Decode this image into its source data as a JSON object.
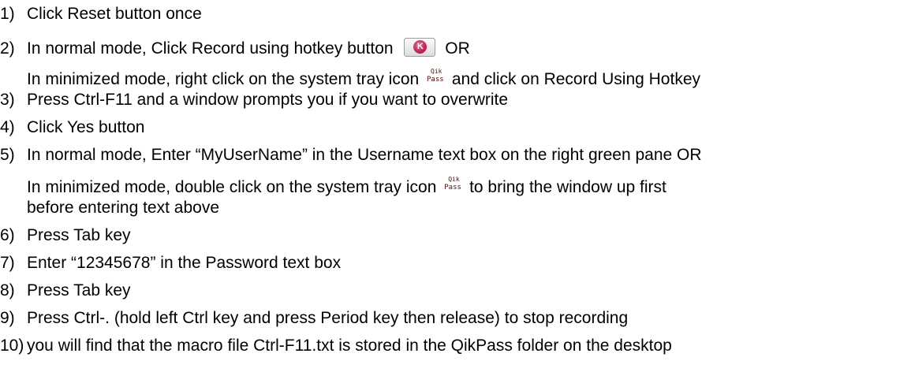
{
  "steps": [
    {
      "num": "1)",
      "text": "Click Reset button once"
    },
    {
      "num": "2)",
      "text_before": "In normal mode, Click Record using hotkey button",
      "button_letter": "K",
      "text_after": "OR",
      "cont_before": "In minimized mode, right click on the system tray icon",
      "tray_top": "Qik",
      "tray_bottom": "Pass",
      "cont_after": "and click on Record Using Hotkey"
    },
    {
      "num": "3)",
      "text": "Press Ctrl-F11 and a window prompts you if you want to overwrite"
    },
    {
      "num": "4)",
      "text": "Click Yes button"
    },
    {
      "num": "5)",
      "text": "In normal mode, Enter “MyUserName” in the Username text box on the right green pane OR",
      "cont_before": "In minimized mode, double click on the system tray icon",
      "tray_top": "Qik",
      "tray_bottom": "Pass",
      "cont_after": "to bring the window up first",
      "cont2": "before entering text above"
    },
    {
      "num": "6)",
      "text": "Press Tab key"
    },
    {
      "num": "7)",
      "text": "Enter “12345678” in the Password text box"
    },
    {
      "num": "8)",
      "text": "Press Tab key"
    },
    {
      "num": "9)",
      "text": "Press Ctrl-. (hold left Ctrl key and press Period key then release) to stop recording"
    },
    {
      "num": "10)",
      "text": "you will find that the macro file Ctrl-F11.txt is stored in the QikPass folder on the desktop"
    }
  ]
}
